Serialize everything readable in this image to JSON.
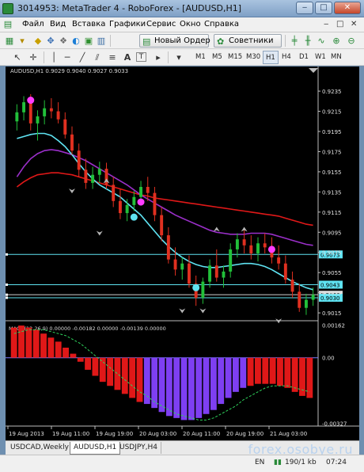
{
  "window": {
    "title": "3014953: MetaTrader 4 - RoboForex - [AUDUSD,H1]",
    "buttons": [
      "‒",
      "□",
      "✕"
    ]
  },
  "menu": {
    "items": [
      "Файл",
      "Вид",
      "Вставка",
      "Графики",
      "Сервис",
      "Окно",
      "Справка"
    ],
    "mdi_controls": [
      "‒",
      "□",
      "✕"
    ]
  },
  "toolbar1": {
    "new_order_label": "Новый Ордер",
    "experts_label": "Советники"
  },
  "toolbar2": {
    "timeframes": [
      "M1",
      "M5",
      "M15",
      "M30",
      "H1",
      "H4",
      "D1",
      "W1",
      "MN"
    ],
    "active_timeframe": "H1"
  },
  "chart_data": {
    "type": "candlestick",
    "symbol_info": "AUDUSD,H1  0.9029 0.9040 0.9027 0.9033",
    "price_ticks": [
      "0.9235",
      "0.9215",
      "0.9195",
      "0.9175",
      "0.9155",
      "0.9135",
      "0.9115",
      "0.9095",
      "0.9075",
      "0.9055",
      "0.9035",
      "0.9015"
    ],
    "ylim": [
      0.9008,
      0.925
    ],
    "price_marks": [
      {
        "label": "0.9073",
        "value": 0.9073
      },
      {
        "label": "0.9043",
        "value": 0.9043
      },
      {
        "label": "0.9033",
        "value": 0.9033
      },
      {
        "label": "0.9030",
        "value": 0.903
      }
    ],
    "time_labels": [
      "19 Aug 2013",
      "19 Aug 11:00",
      "19 Aug 19:00",
      "20 Aug 03:00",
      "20 Aug 11:00",
      "20 Aug 19:00",
      "21 Aug 03:00"
    ],
    "candles": [
      [
        0.9205,
        0.9222,
        0.9196,
        0.9214
      ],
      [
        0.9214,
        0.923,
        0.9206,
        0.9224
      ],
      [
        0.9224,
        0.9232,
        0.9196,
        0.9203
      ],
      [
        0.9203,
        0.9216,
        0.9186,
        0.921
      ],
      [
        0.921,
        0.9226,
        0.9202,
        0.9218
      ],
      [
        0.9218,
        0.9228,
        0.9208,
        0.9215
      ],
      [
        0.9215,
        0.9224,
        0.9203,
        0.9207
      ],
      [
        0.9207,
        0.9214,
        0.9188,
        0.9192
      ],
      [
        0.9192,
        0.92,
        0.9172,
        0.9176
      ],
      [
        0.9176,
        0.9183,
        0.915,
        0.9157
      ],
      [
        0.9157,
        0.9168,
        0.9138,
        0.9144
      ],
      [
        0.9144,
        0.916,
        0.9138,
        0.9152
      ],
      [
        0.9152,
        0.9165,
        0.9144,
        0.9158
      ],
      [
        0.9158,
        0.9164,
        0.9138,
        0.9142
      ],
      [
        0.9142,
        0.915,
        0.912,
        0.9126
      ],
      [
        0.9126,
        0.9138,
        0.9108,
        0.9114
      ],
      [
        0.9114,
        0.9128,
        0.9106,
        0.9122
      ],
      [
        0.9122,
        0.9136,
        0.9116,
        0.913
      ],
      [
        0.913,
        0.9146,
        0.9124,
        0.914
      ],
      [
        0.914,
        0.915,
        0.9126,
        0.9134
      ],
      [
        0.9134,
        0.914,
        0.9106,
        0.9112
      ],
      [
        0.9112,
        0.912,
        0.9086,
        0.9092
      ],
      [
        0.9092,
        0.91,
        0.9064,
        0.9068
      ],
      [
        0.9068,
        0.908,
        0.9052,
        0.9058
      ],
      [
        0.9058,
        0.907,
        0.9048,
        0.9064
      ],
      [
        0.9064,
        0.9072,
        0.904,
        0.9044
      ],
      [
        0.9044,
        0.9052,
        0.9022,
        0.903
      ],
      [
        0.903,
        0.905,
        0.9024,
        0.9046
      ],
      [
        0.9046,
        0.9068,
        0.904,
        0.9062
      ],
      [
        0.9062,
        0.9078,
        0.9046,
        0.905
      ],
      [
        0.905,
        0.9062,
        0.904,
        0.9056
      ],
      [
        0.9056,
        0.9084,
        0.905,
        0.9078
      ],
      [
        0.9078,
        0.9094,
        0.907,
        0.9088
      ],
      [
        0.9088,
        0.9098,
        0.9074,
        0.9082
      ],
      [
        0.9082,
        0.9092,
        0.9068,
        0.9074
      ],
      [
        0.9074,
        0.909,
        0.9066,
        0.9084
      ],
      [
        0.9084,
        0.9094,
        0.9074,
        0.908
      ],
      [
        0.908,
        0.909,
        0.9064,
        0.907
      ],
      [
        0.907,
        0.9082,
        0.9058,
        0.9064
      ],
      [
        0.9064,
        0.9072,
        0.9044,
        0.9048
      ],
      [
        0.9048,
        0.9056,
        0.903,
        0.9036
      ],
      [
        0.9036,
        0.9044,
        0.9016,
        0.902
      ],
      [
        0.902,
        0.9034,
        0.9013,
        0.9028
      ],
      [
        0.9028,
        0.904,
        0.9022,
        0.9033
      ]
    ],
    "ma_cyan": [
      0.9188,
      0.919,
      0.9192,
      0.9193,
      0.9193,
      0.9191,
      0.9186,
      0.918,
      0.9172,
      0.9163,
      0.9155,
      0.9148,
      0.9142,
      0.9138,
      0.9134,
      0.913,
      0.9124,
      0.9118,
      0.9112,
      0.9104,
      0.9096,
      0.9088,
      0.9081,
      0.9075,
      0.907,
      0.9066,
      0.9063,
      0.9061,
      0.906,
      0.906,
      0.9061,
      0.9062,
      0.9063,
      0.9064,
      0.9064,
      0.9063,
      0.9061,
      0.9058,
      0.9054,
      0.905,
      0.9046,
      0.9043,
      0.904,
      0.9038
    ],
    "ma_purple": [
      0.915,
      0.916,
      0.9168,
      0.9173,
      0.9176,
      0.9177,
      0.9176,
      0.9174,
      0.9172,
      0.9169,
      0.9166,
      0.9162,
      0.9158,
      0.9154,
      0.915,
      0.9146,
      0.9142,
      0.9137,
      0.9132,
      0.9128,
      0.9124,
      0.912,
      0.9116,
      0.9112,
      0.9109,
      0.9106,
      0.9103,
      0.91,
      0.9097,
      0.9095,
      0.9094,
      0.9093,
      0.9093,
      0.9093,
      0.9094,
      0.9094,
      0.9094,
      0.9093,
      0.9091,
      0.9089,
      0.9087,
      0.9085,
      0.9083,
      0.9082
    ],
    "ma_red": [
      0.914,
      0.9145,
      0.9149,
      0.9152,
      0.9153,
      0.9154,
      0.9154,
      0.9153,
      0.9152,
      0.915,
      0.9148,
      0.9146,
      0.9144,
      0.9142,
      0.914,
      0.9138,
      0.9136,
      0.9134,
      0.9132,
      0.9131,
      0.9129,
      0.9128,
      0.9127,
      0.9126,
      0.9125,
      0.9124,
      0.9123,
      0.9122,
      0.9121,
      0.912,
      0.9119,
      0.9118,
      0.9117,
      0.9116,
      0.9115,
      0.9114,
      0.9113,
      0.9112,
      0.9111,
      0.9109,
      0.9107,
      0.9105,
      0.9103,
      0.9102
    ],
    "signals": [
      {
        "type": "magenta-dot",
        "i": 2,
        "value": 0.9226
      },
      {
        "type": "magenta-dot",
        "i": 18,
        "value": 0.9125
      },
      {
        "type": "magenta-dot",
        "i": 37,
        "value": 0.9078
      },
      {
        "type": "cyan-dot",
        "i": 17,
        "value": 0.911
      },
      {
        "type": "cyan-dot",
        "i": 26,
        "value": 0.904
      }
    ],
    "fractals": [
      {
        "dir": "down",
        "i": 8,
        "value": 0.9136
      },
      {
        "dir": "up",
        "i": 13,
        "value": 0.9146
      },
      {
        "dir": "down",
        "i": 12,
        "value": 0.9094
      },
      {
        "dir": "down",
        "i": 24,
        "value": 0.9017
      },
      {
        "dir": "down",
        "i": 27,
        "value": 0.9017
      },
      {
        "dir": "up",
        "i": 29,
        "value": 0.9098
      },
      {
        "dir": "up",
        "i": 33,
        "value": 0.9098
      },
      {
        "dir": "down",
        "i": 38,
        "value": 0.9007
      }
    ],
    "macd": {
      "label": "MACD(12,26,9) 0.00000 -0.00182 0.00000 -0.00139 0.00000",
      "ticks": [
        "0.00162",
        "0.00",
        "-0.00327"
      ],
      "ylim": [
        -0.0034,
        0.0018
      ],
      "bars": [
        0.0015,
        0.0016,
        0.0015,
        0.0014,
        0.0012,
        0.001,
        0.0008,
        0.0005,
        0.0002,
        -0.0002,
        -0.0006,
        -0.0009,
        -0.0012,
        -0.0014,
        -0.0016,
        -0.0018,
        -0.002,
        -0.0022,
        -0.0023,
        -0.0025,
        -0.0027,
        -0.0029,
        -0.003,
        -0.0031,
        -0.0031,
        -0.003,
        -0.0028,
        -0.0026,
        -0.0023,
        -0.002,
        -0.0017,
        -0.0015,
        -0.0014,
        -0.0013,
        -0.0013,
        -0.0013,
        -0.0014,
        -0.0015,
        -0.0017,
        -0.0019,
        -0.002
      ],
      "bar_colors": [
        "red",
        "red",
        "red",
        "red",
        "red",
        "red",
        "red",
        "red",
        "red",
        "red",
        "red",
        "red",
        "red",
        "red",
        "red",
        "red",
        "red",
        "red",
        "purple",
        "purple",
        "purple",
        "purple",
        "purple",
        "purple",
        "purple",
        "purple",
        "purple",
        "purple",
        "purple",
        "purple",
        "purple",
        "purple",
        "red",
        "red",
        "red",
        "red",
        "red",
        "red",
        "red",
        "red",
        "red"
      ],
      "signal": [
        0.0012,
        0.0013,
        0.0014,
        0.0014,
        0.0014,
        0.0013,
        0.0012,
        0.0011,
        0.0009,
        0.0007,
        0.0004,
        0.0001,
        -0.0002,
        -0.0005,
        -0.0008,
        -0.0011,
        -0.0014,
        -0.0017,
        -0.0019,
        -0.0022,
        -0.0024,
        -0.0026,
        -0.0028,
        -0.0029,
        -0.003,
        -0.0031,
        -0.0031,
        -0.003,
        -0.0028,
        -0.0026,
        -0.0024,
        -0.0021,
        -0.0019,
        -0.0017,
        -0.0015,
        -0.0014,
        -0.0014,
        -0.0014,
        -0.0015,
        -0.0016,
        -0.0017
      ]
    },
    "colors": {
      "up": "#22c03a",
      "down": "#e03020",
      "cyan": "#5fe3f2",
      "purple": "#9a2fc9",
      "red": "#e01818",
      "magenta": "#ff3cff",
      "hist_red": "#e01818",
      "hist_purple": "#7e3ff2"
    }
  },
  "tabs": [
    "USDCAD,Weekly",
    "AUDUSD,H1",
    "USDJPY,H4"
  ],
  "active_tab": "AUDUSD,H1",
  "watermark": "forex.osobye.ru",
  "status": {
    "lang": "EN",
    "conn": "190/1 kb",
    "time": "07:24"
  }
}
